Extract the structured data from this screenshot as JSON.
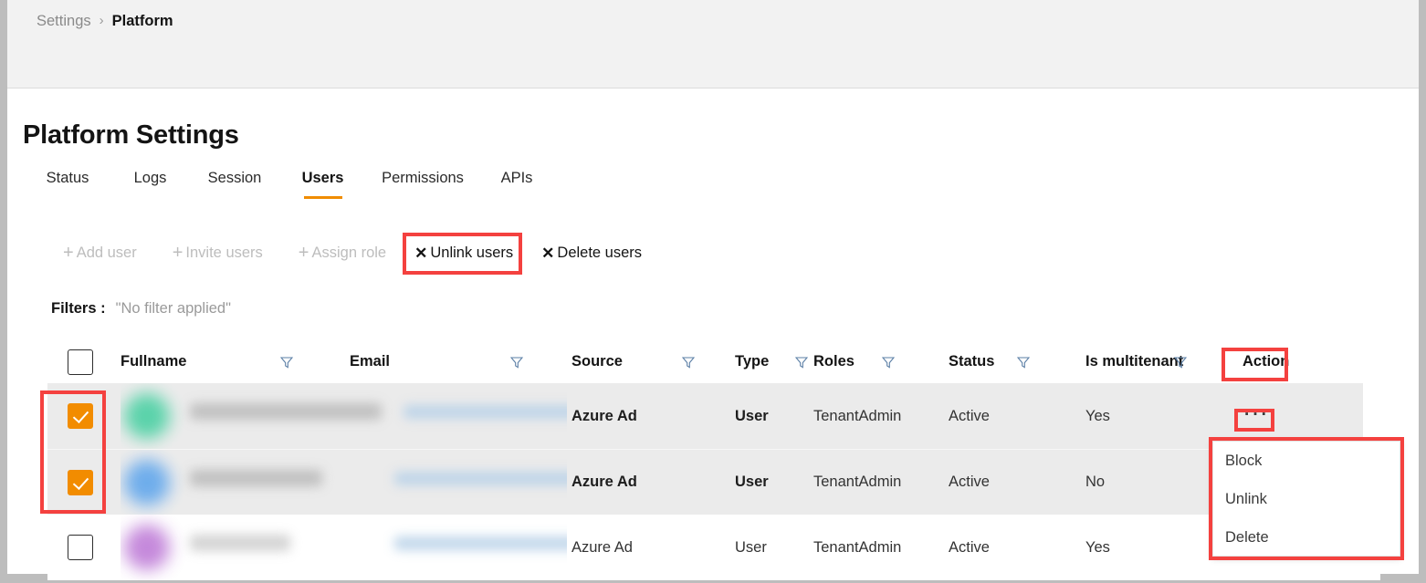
{
  "breadcrumb": {
    "parent": "Settings",
    "separator": "›",
    "current": "Platform"
  },
  "page": {
    "title": "Platform Settings"
  },
  "tabs": [
    {
      "label": "Status",
      "active": false
    },
    {
      "label": "Logs",
      "active": false
    },
    {
      "label": "Session",
      "active": false
    },
    {
      "label": "Users",
      "active": true
    },
    {
      "label": "Permissions",
      "active": false
    },
    {
      "label": "APIs",
      "active": false
    }
  ],
  "toolbar": {
    "add_user": "Add user",
    "invite_users": "Invite users",
    "assign_role": "Assign role",
    "unlink_users": "Unlink users",
    "delete_users": "Delete users",
    "plus_glyph": "+",
    "x_glyph": "✕"
  },
  "filters": {
    "label": "Filters :",
    "value": "\"No filter applied\""
  },
  "table": {
    "columns": [
      {
        "key": "fullname",
        "label": "Fullname",
        "filterable": true
      },
      {
        "key": "email",
        "label": "Email",
        "filterable": true
      },
      {
        "key": "source",
        "label": "Source",
        "filterable": true
      },
      {
        "key": "type",
        "label": "Type",
        "filterable": true
      },
      {
        "key": "roles",
        "label": "Roles",
        "filterable": true
      },
      {
        "key": "status",
        "label": "Status",
        "filterable": true
      },
      {
        "key": "is_multitenant",
        "label": "Is multitenant",
        "filterable": true
      },
      {
        "key": "action",
        "label": "Action",
        "filterable": false
      }
    ],
    "rows": [
      {
        "selected": true,
        "fullname": "",
        "email": "",
        "source": "Azure Ad",
        "type": "User",
        "roles": "TenantAdmin",
        "status": "Active",
        "is_multitenant": "Yes",
        "action_glyph": "···",
        "avatar_color": "#4fd1a5"
      },
      {
        "selected": true,
        "fullname": "",
        "email": "",
        "source": "Azure Ad",
        "type": "User",
        "roles": "TenantAdmin",
        "status": "Active",
        "is_multitenant": "No",
        "action_glyph": "",
        "avatar_color": "#64a8ec"
      },
      {
        "selected": false,
        "fullname": "",
        "email": "",
        "source": "Azure Ad",
        "type": "User",
        "roles": "TenantAdmin",
        "status": "Active",
        "is_multitenant": "Yes",
        "action_glyph": "",
        "avatar_color": "#c07fd8"
      }
    ]
  },
  "action_menu": {
    "items": [
      {
        "label": "Block"
      },
      {
        "label": "Unlink"
      },
      {
        "label": "Delete"
      }
    ]
  },
  "colors": {
    "accent_orange": "#f28c00",
    "annotation_red": "#f4413f",
    "selected_row": "#ebebeb",
    "header_bar": "#f2f2f2",
    "chrome_gray": "#bdbdbd"
  }
}
